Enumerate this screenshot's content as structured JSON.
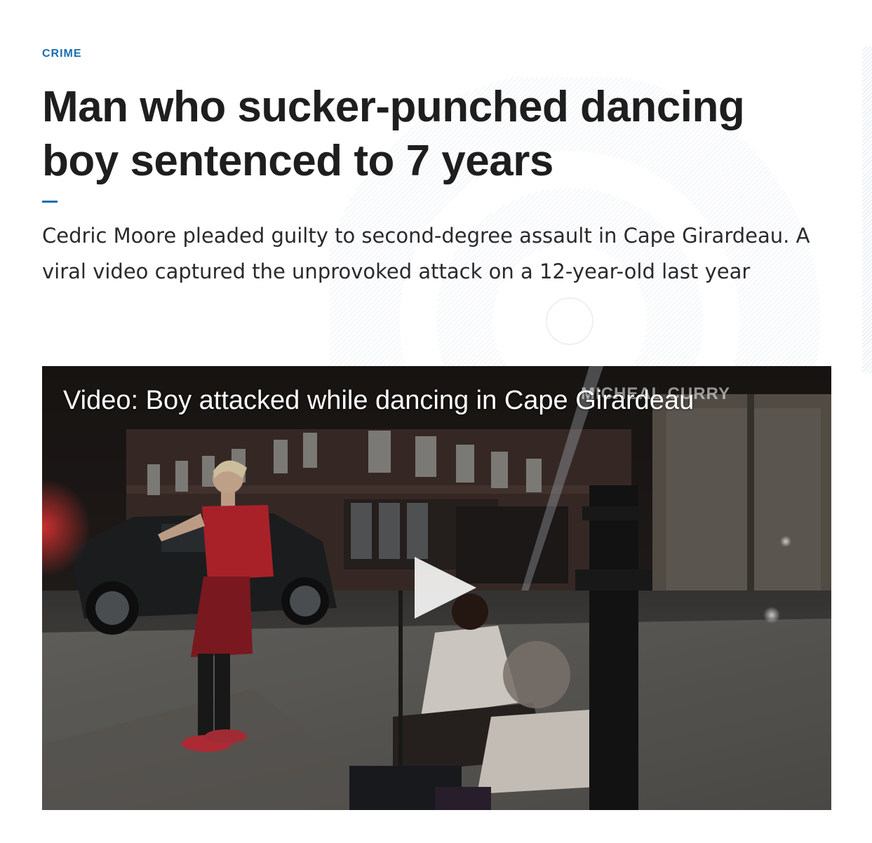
{
  "article": {
    "category": "CRIME",
    "headline": "Man who sucker-punched dancing boy sentenced to 7 years",
    "dek": "Cedric Moore pleaded guilty to second-degree assault in Cape Girardeau. A viral video captured the unprovoked attack on a 12-year-old last year"
  },
  "video": {
    "title": "Video: Boy attacked while dancing in Cape Girardeau",
    "watermark": "MICHEAL CURRY",
    "play_icon": "play-icon"
  },
  "colors": {
    "accent": "#1b6db0",
    "headline": "#1e1e1e",
    "dek": "#2a2a2a"
  }
}
